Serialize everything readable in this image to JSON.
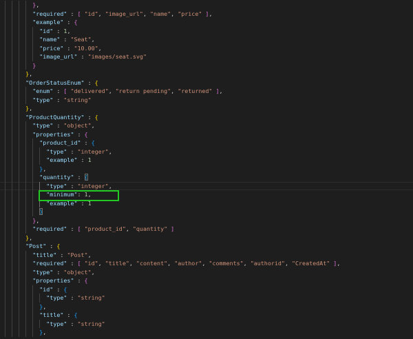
{
  "colors": {
    "background": "#1e1e1e",
    "key": "#9cdcfe",
    "string": "#ce9178",
    "number": "#b5cea8",
    "bracket_1": "#ffd700",
    "bracket_2": "#da70d6",
    "bracket_3": "#179fff",
    "annotation_box": "#22c922"
  },
  "editor": {
    "current_line": 22,
    "highlighted_line": 23,
    "lines": [
      {
        "indent": 8,
        "tokens": [
          [
            "b2",
            "}"
          ],
          [
            "p",
            ","
          ]
        ]
      },
      {
        "indent": 8,
        "tokens": [
          [
            "k",
            "\"required\""
          ],
          [
            "p",
            " : "
          ],
          [
            "b2",
            "["
          ],
          [
            "p",
            " "
          ],
          [
            "s",
            "\"id\""
          ],
          [
            "p",
            ", "
          ],
          [
            "s",
            "\"image_url\""
          ],
          [
            "p",
            ", "
          ],
          [
            "s",
            "\"name\""
          ],
          [
            "p",
            ", "
          ],
          [
            "s",
            "\"price\""
          ],
          [
            "p",
            " "
          ],
          [
            "b2",
            "]"
          ],
          [
            "p",
            ","
          ]
        ]
      },
      {
        "indent": 8,
        "tokens": [
          [
            "k",
            "\"example\""
          ],
          [
            "p",
            " : "
          ],
          [
            "b2",
            "{"
          ]
        ]
      },
      {
        "indent": 10,
        "tokens": [
          [
            "k",
            "\"id\""
          ],
          [
            "p",
            " : "
          ],
          [
            "n",
            "1"
          ],
          [
            "p",
            ","
          ]
        ]
      },
      {
        "indent": 10,
        "tokens": [
          [
            "k",
            "\"name\""
          ],
          [
            "p",
            " : "
          ],
          [
            "s",
            "\"Seat\""
          ],
          [
            "p",
            ","
          ]
        ]
      },
      {
        "indent": 10,
        "tokens": [
          [
            "k",
            "\"price\""
          ],
          [
            "p",
            " : "
          ],
          [
            "s",
            "\"10.00\""
          ],
          [
            "p",
            ","
          ]
        ]
      },
      {
        "indent": 10,
        "tokens": [
          [
            "k",
            "\"image_url\""
          ],
          [
            "p",
            " : "
          ],
          [
            "s",
            "\"images/seat.svg\""
          ]
        ]
      },
      {
        "indent": 8,
        "tokens": [
          [
            "b2",
            "}"
          ]
        ]
      },
      {
        "indent": 6,
        "tokens": [
          [
            "b1",
            "}"
          ],
          [
            "p",
            ","
          ]
        ]
      },
      {
        "indent": 6,
        "tokens": [
          [
            "k",
            "\"OrderStatusEnum\""
          ],
          [
            "p",
            " : "
          ],
          [
            "b1",
            "{"
          ]
        ]
      },
      {
        "indent": 8,
        "tokens": [
          [
            "k",
            "\"enum\""
          ],
          [
            "p",
            " : "
          ],
          [
            "b2",
            "["
          ],
          [
            "p",
            " "
          ],
          [
            "s",
            "\"delivered\""
          ],
          [
            "p",
            ", "
          ],
          [
            "s",
            "\"return pending\""
          ],
          [
            "p",
            ", "
          ],
          [
            "s",
            "\"returned\""
          ],
          [
            "p",
            " "
          ],
          [
            "b2",
            "]"
          ],
          [
            "p",
            ","
          ]
        ]
      },
      {
        "indent": 8,
        "tokens": [
          [
            "k",
            "\"type\""
          ],
          [
            "p",
            " : "
          ],
          [
            "s",
            "\"string\""
          ]
        ]
      },
      {
        "indent": 6,
        "tokens": [
          [
            "b1",
            "}"
          ],
          [
            "p",
            ","
          ]
        ]
      },
      {
        "indent": 6,
        "tokens": [
          [
            "k",
            "\"ProductQuantity\""
          ],
          [
            "p",
            " : "
          ],
          [
            "b1",
            "{"
          ]
        ]
      },
      {
        "indent": 8,
        "tokens": [
          [
            "k",
            "\"type\""
          ],
          [
            "p",
            " : "
          ],
          [
            "s",
            "\"object\""
          ],
          [
            "p",
            ","
          ]
        ]
      },
      {
        "indent": 8,
        "tokens": [
          [
            "k",
            "\"properties\""
          ],
          [
            "p",
            " : "
          ],
          [
            "b2",
            "{"
          ]
        ]
      },
      {
        "indent": 10,
        "tokens": [
          [
            "k",
            "\"product_id\""
          ],
          [
            "p",
            " : "
          ],
          [
            "b3",
            "{"
          ]
        ]
      },
      {
        "indent": 12,
        "tokens": [
          [
            "k",
            "\"type\""
          ],
          [
            "p",
            " : "
          ],
          [
            "s",
            "\"integer\""
          ],
          [
            "p",
            ","
          ]
        ]
      },
      {
        "indent": 12,
        "tokens": [
          [
            "k",
            "\"example\""
          ],
          [
            "p",
            " : "
          ],
          [
            "n",
            "1"
          ]
        ]
      },
      {
        "indent": 10,
        "tokens": [
          [
            "b3",
            "}"
          ],
          [
            "p",
            ","
          ]
        ]
      },
      {
        "indent": 10,
        "tokens": [
          [
            "k",
            "\"quantity\""
          ],
          [
            "p",
            " : "
          ],
          [
            "b3 match",
            "{"
          ]
        ]
      },
      {
        "indent": 12,
        "tokens": [
          [
            "k",
            "\"type\""
          ],
          [
            "p",
            " : "
          ],
          [
            "s",
            "\"integer\""
          ],
          [
            "p",
            ","
          ]
        ]
      },
      {
        "indent": 12,
        "tokens": [
          [
            "k",
            "\"minimum\""
          ],
          [
            "p",
            ": "
          ],
          [
            "n",
            "1"
          ],
          [
            "p",
            ","
          ]
        ]
      },
      {
        "indent": 12,
        "tokens": [
          [
            "k",
            "\"example\""
          ],
          [
            "p",
            " : "
          ],
          [
            "n",
            "1"
          ]
        ]
      },
      {
        "indent": 10,
        "tokens": [
          [
            "b3 match",
            "}"
          ]
        ]
      },
      {
        "indent": 8,
        "tokens": [
          [
            "b2",
            "}"
          ],
          [
            "p",
            ","
          ]
        ]
      },
      {
        "indent": 8,
        "tokens": [
          [
            "k",
            "\"required\""
          ],
          [
            "p",
            " : "
          ],
          [
            "b2",
            "["
          ],
          [
            "p",
            " "
          ],
          [
            "s",
            "\"product_id\""
          ],
          [
            "p",
            ", "
          ],
          [
            "s",
            "\"quantity\""
          ],
          [
            "p",
            " "
          ],
          [
            "b2",
            "]"
          ]
        ]
      },
      {
        "indent": 6,
        "tokens": [
          [
            "b1",
            "}"
          ],
          [
            "p",
            ","
          ]
        ]
      },
      {
        "indent": 6,
        "tokens": [
          [
            "k",
            "\"Post\""
          ],
          [
            "p",
            " : "
          ],
          [
            "b1",
            "{"
          ]
        ]
      },
      {
        "indent": 8,
        "tokens": [
          [
            "k",
            "\"title\""
          ],
          [
            "p",
            " : "
          ],
          [
            "s",
            "\"Post\""
          ],
          [
            "p",
            ","
          ]
        ]
      },
      {
        "indent": 8,
        "tokens": [
          [
            "k",
            "\"required\""
          ],
          [
            "p",
            " : "
          ],
          [
            "b2",
            "["
          ],
          [
            "p",
            " "
          ],
          [
            "s",
            "\"id\""
          ],
          [
            "p",
            ", "
          ],
          [
            "s",
            "\"title\""
          ],
          [
            "p",
            ", "
          ],
          [
            "s",
            "\"content\""
          ],
          [
            "p",
            ", "
          ],
          [
            "s",
            "\"author\""
          ],
          [
            "p",
            ", "
          ],
          [
            "s",
            "\"comments\""
          ],
          [
            "p",
            ", "
          ],
          [
            "s",
            "\"authorid\""
          ],
          [
            "p",
            ", "
          ],
          [
            "s",
            "\"CreatedAt\""
          ],
          [
            "p",
            " "
          ],
          [
            "b2",
            "]"
          ],
          [
            "p",
            ","
          ]
        ]
      },
      {
        "indent": 8,
        "tokens": [
          [
            "k",
            "\"type\""
          ],
          [
            "p",
            " : "
          ],
          [
            "s",
            "\"object\""
          ],
          [
            "p",
            ","
          ]
        ]
      },
      {
        "indent": 8,
        "tokens": [
          [
            "k",
            "\"properties\""
          ],
          [
            "p",
            " : "
          ],
          [
            "b2",
            "{"
          ]
        ]
      },
      {
        "indent": 10,
        "tokens": [
          [
            "k",
            "\"id\""
          ],
          [
            "p",
            " : "
          ],
          [
            "b3",
            "{"
          ]
        ]
      },
      {
        "indent": 12,
        "tokens": [
          [
            "k",
            "\"type\""
          ],
          [
            "p",
            " : "
          ],
          [
            "s",
            "\"string\""
          ]
        ]
      },
      {
        "indent": 10,
        "tokens": [
          [
            "b3",
            "}"
          ],
          [
            "p",
            ","
          ]
        ]
      },
      {
        "indent": 10,
        "tokens": [
          [
            "k",
            "\"title\""
          ],
          [
            "p",
            " : "
          ],
          [
            "b3",
            "{"
          ]
        ]
      },
      {
        "indent": 12,
        "tokens": [
          [
            "k",
            "\"type\""
          ],
          [
            "p",
            " : "
          ],
          [
            "s",
            "\"string\""
          ]
        ]
      },
      {
        "indent": 10,
        "tokens": [
          [
            "b3",
            "}"
          ],
          [
            "p",
            ","
          ]
        ]
      }
    ]
  }
}
